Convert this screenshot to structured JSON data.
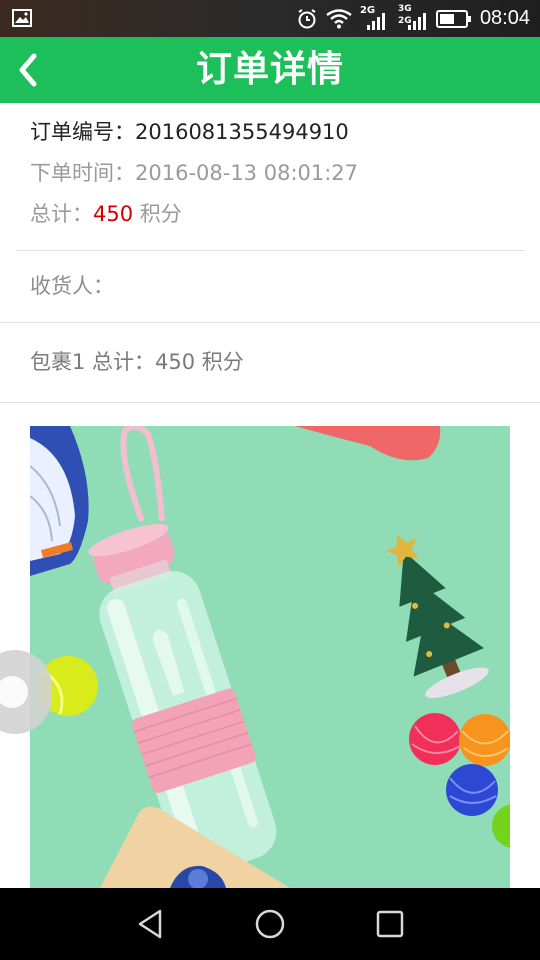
{
  "status_bar": {
    "time": "08:04",
    "net_2g": "2G",
    "net_3g": "3G",
    "net_2g_b": "2G"
  },
  "header": {
    "title": "订单详情"
  },
  "order": {
    "number_label": "订单编号：",
    "number_value": "2016081355494910",
    "time_label": "下单时间：",
    "time_value": "2016-08-13 08:01:27",
    "total_label": "总计：",
    "total_points": "450",
    "total_unit": " 积分"
  },
  "receiver": {
    "label": "收货人："
  },
  "package": {
    "summary": "包裹1 总计：450 积分"
  },
  "icons": {
    "back": "chevron-left-icon",
    "gallery": "image-icon",
    "alarm": "alarm-icon",
    "wifi": "wifi-icon",
    "battery": "battery-icon",
    "nav_back": "triangle-back-icon",
    "nav_home": "circle-home-icon",
    "nav_recent": "square-recents-icon"
  },
  "colors": {
    "header": "#1dbf5a",
    "points": "#d00000",
    "product_bg": "#8fdcb6"
  }
}
